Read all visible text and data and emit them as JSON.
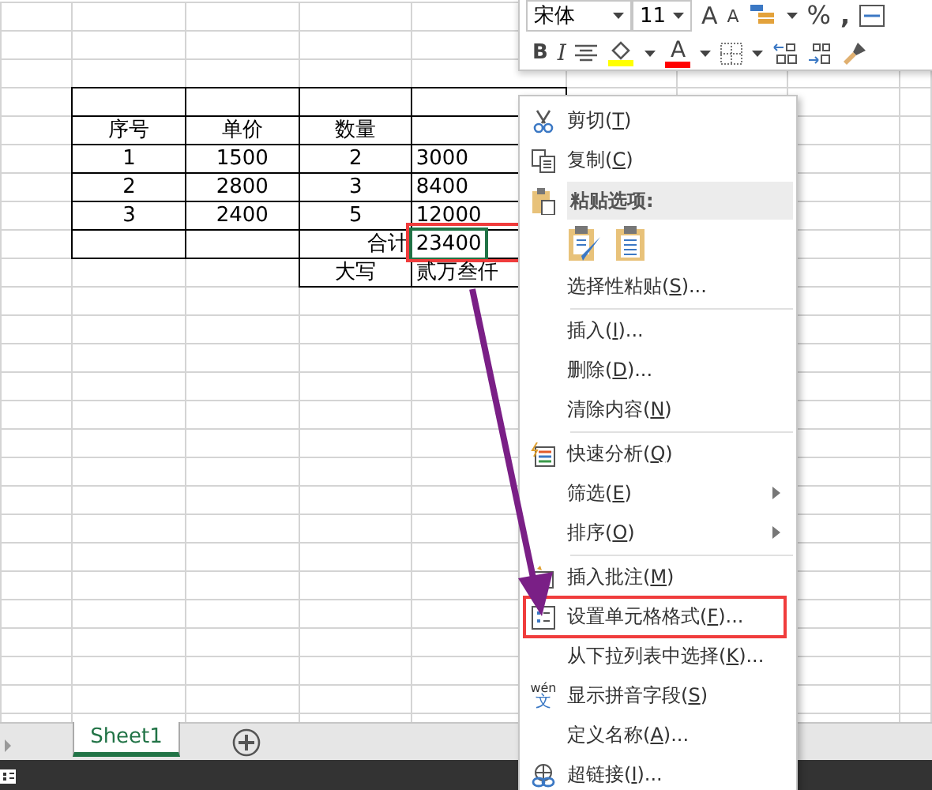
{
  "toolbar": {
    "font": "宋体",
    "size": "11",
    "grow": "A",
    "shrink": "A",
    "percent": "%",
    "comma": ",",
    "bold": "B",
    "italic": "I",
    "font_color": "A"
  },
  "sheet": {
    "columns": [
      "序号",
      "单价",
      "数量"
    ],
    "rows": [
      [
        "1",
        "1500",
        "2",
        "3000"
      ],
      [
        "2",
        "2800",
        "3",
        "8400"
      ],
      [
        "3",
        "2400",
        "5",
        "12000"
      ]
    ],
    "total": {
      "label": "合计",
      "value": "23400",
      "selected": true,
      "highlighted": true
    },
    "in_words": {
      "label": "大写",
      "value": "贰万叁仟"
    }
  },
  "context_menu": {
    "items": [
      {
        "kind": "item",
        "before": "剪切(",
        "key": "T",
        "after": ")",
        "submenu": false,
        "marked": false
      },
      {
        "kind": "item",
        "before": "复制(",
        "key": "C",
        "after": ")",
        "submenu": false,
        "marked": false
      },
      {
        "kind": "header",
        "text": "粘贴选项:"
      },
      {
        "kind": "paste_icons"
      },
      {
        "kind": "item",
        "before": "选择性粘贴(",
        "key": "S",
        "after": ")...",
        "submenu": false,
        "marked": false
      },
      {
        "kind": "separator"
      },
      {
        "kind": "item",
        "before": "插入(",
        "key": "I",
        "after": ")...",
        "submenu": false,
        "marked": false
      },
      {
        "kind": "item",
        "before": "删除(",
        "key": "D",
        "after": ")...",
        "submenu": false,
        "marked": false
      },
      {
        "kind": "item",
        "before": "清除内容(",
        "key": "N",
        "after": ")",
        "submenu": false,
        "marked": false
      },
      {
        "kind": "separator"
      },
      {
        "kind": "item",
        "before": "快速分析(",
        "key": "Q",
        "after": ")",
        "submenu": false,
        "marked": false
      },
      {
        "kind": "item",
        "before": "筛选(",
        "key": "E",
        "after": ")",
        "submenu": true,
        "marked": false
      },
      {
        "kind": "item",
        "before": "排序(",
        "key": "O",
        "after": ")",
        "submenu": true,
        "marked": false
      },
      {
        "kind": "separator"
      },
      {
        "kind": "item",
        "before": "插入批注(",
        "key": "M",
        "after": ")",
        "submenu": false,
        "marked": false
      },
      {
        "kind": "item",
        "before": "设置单元格格式(",
        "key": "F",
        "after": ")...",
        "submenu": false,
        "marked": true
      },
      {
        "kind": "item",
        "before": "从下拉列表中选择(",
        "key": "K",
        "after": ")...",
        "submenu": false,
        "marked": false
      },
      {
        "kind": "item",
        "before": "显示拼音字段(",
        "key": "S",
        "after": ")",
        "submenu": false,
        "marked": false,
        "icon_top": "wén",
        "icon_bottom": "文"
      },
      {
        "kind": "item",
        "before": "定义名称(",
        "key": "A",
        "after": ")...",
        "submenu": false,
        "marked": false
      },
      {
        "kind": "item",
        "before": "超链接(",
        "key": "I",
        "after": ")...",
        "submenu": false,
        "marked": false
      }
    ]
  },
  "sheet_tabs": [
    {
      "label": "Sheet1",
      "selected": true
    }
  ]
}
